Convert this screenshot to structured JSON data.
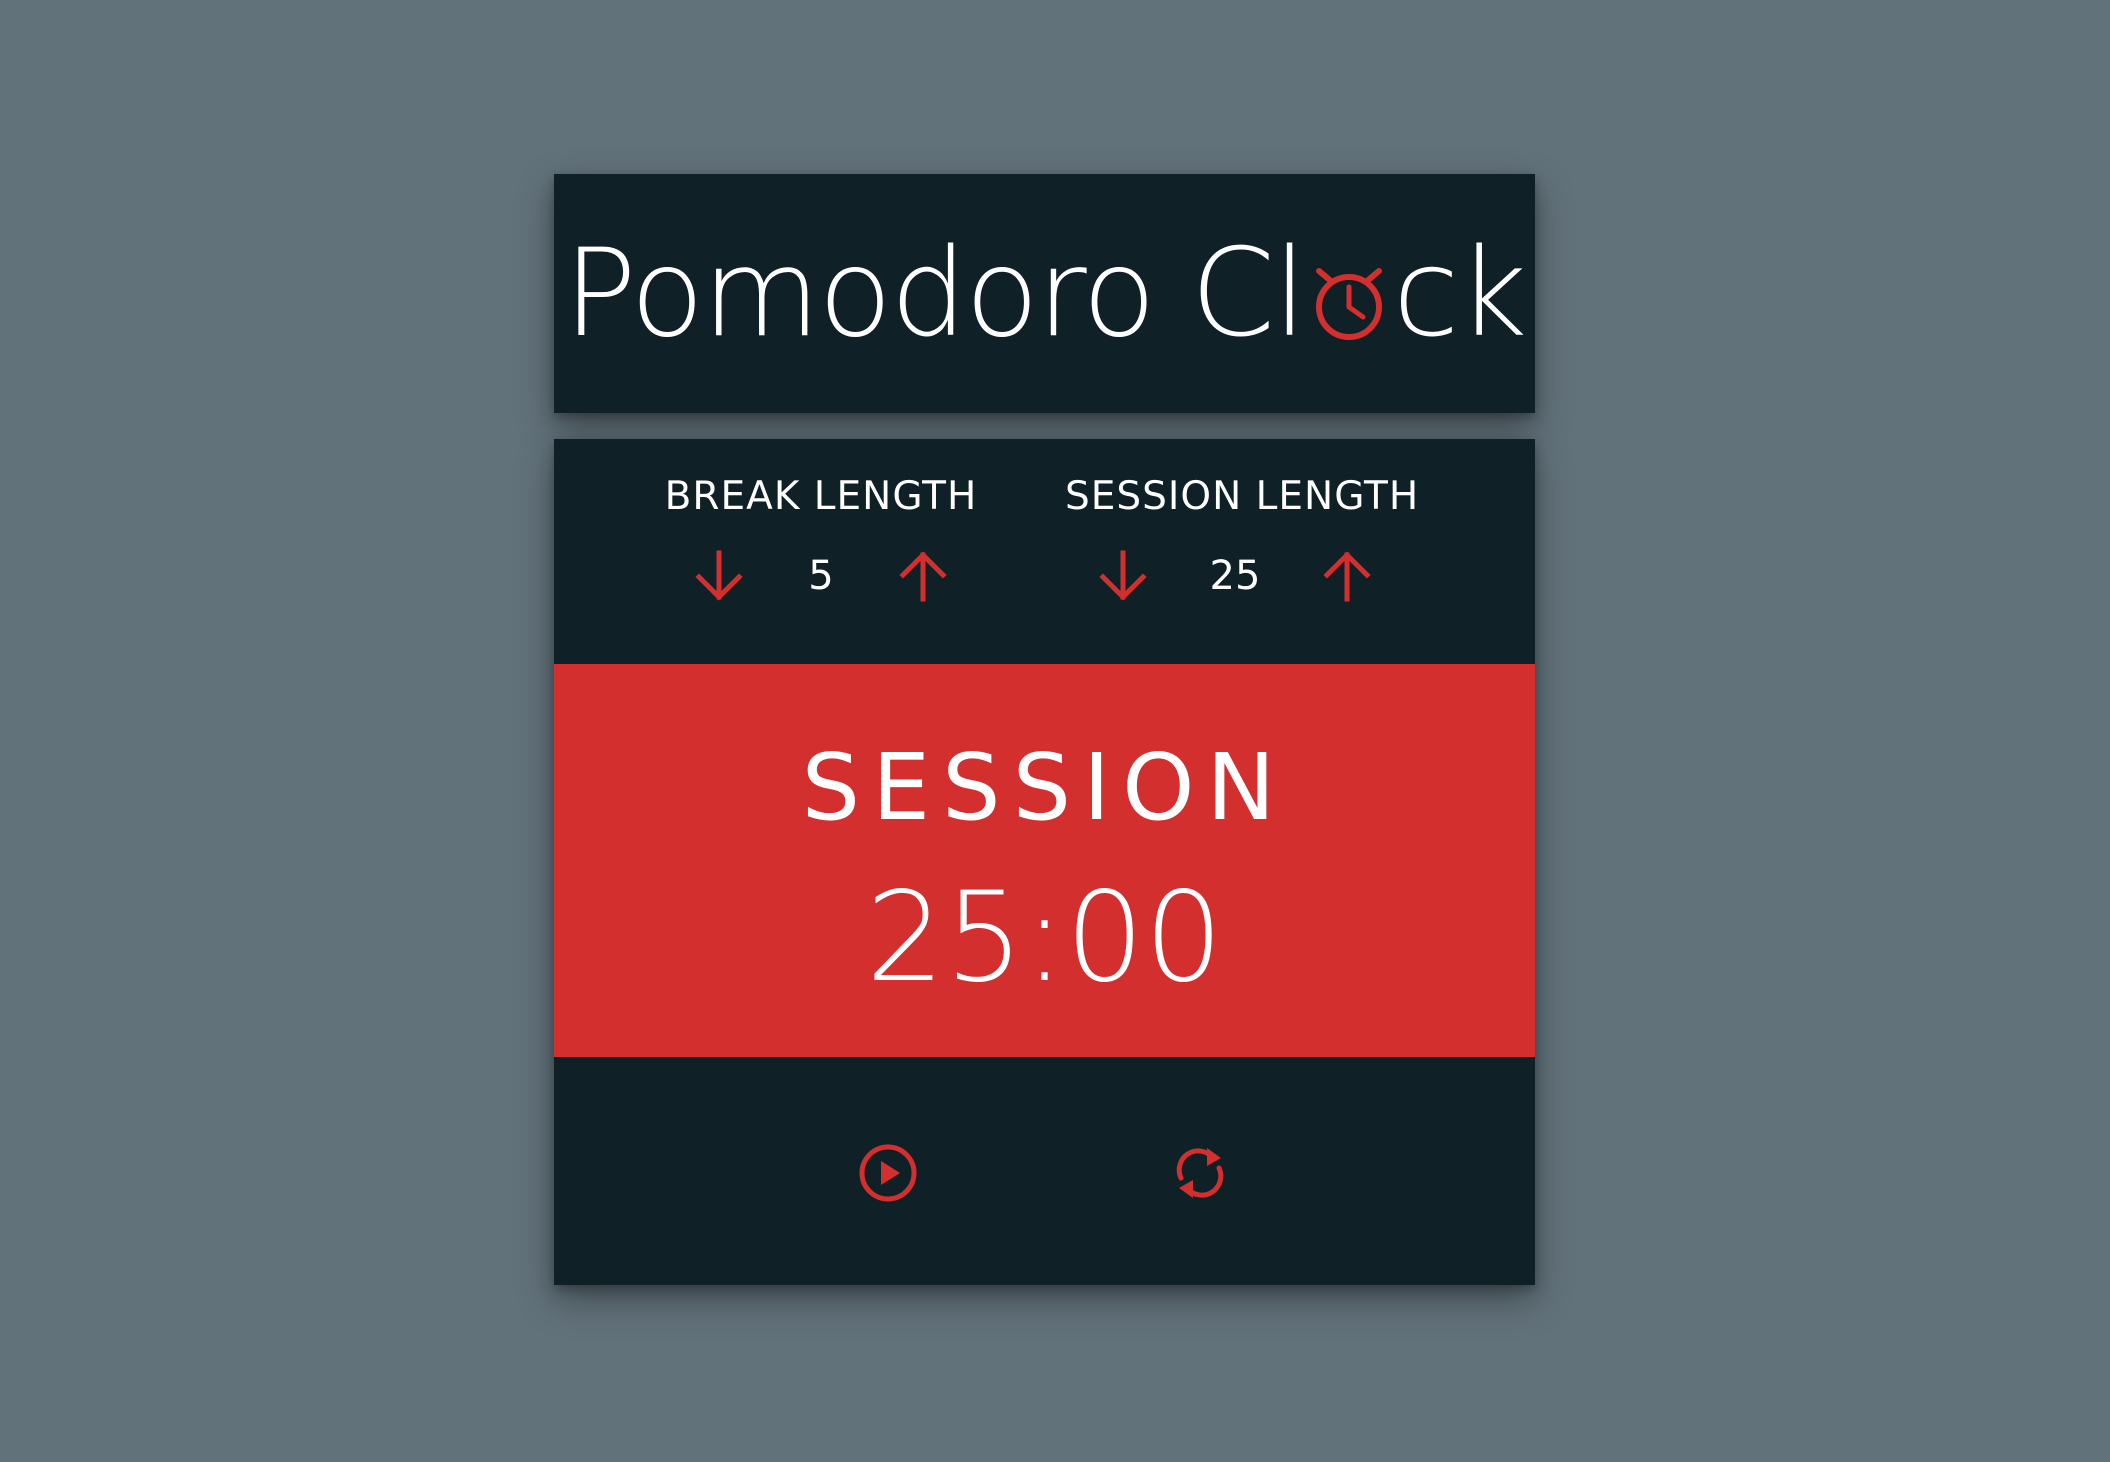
{
  "header": {
    "title_prefix": "Pomodoro Cl",
    "title_suffix": "ck",
    "title_icon": "alarm-clock-icon"
  },
  "break": {
    "label": "BREAK LENGTH",
    "value": "5",
    "decrement_icon": "arrow-down-icon",
    "increment_icon": "arrow-up-icon"
  },
  "session": {
    "label": "SESSION LENGTH",
    "value": "25",
    "decrement_icon": "arrow-down-icon",
    "increment_icon": "arrow-up-icon"
  },
  "timer": {
    "label": "SESSION",
    "time": "25:00"
  },
  "controls": {
    "start_icon": "play-circle-icon",
    "reset_icon": "refresh-icon"
  },
  "colors": {
    "background": "#62727b",
    "panel": "#102027",
    "accent": "#d32f2f",
    "text": "#ffffff"
  }
}
